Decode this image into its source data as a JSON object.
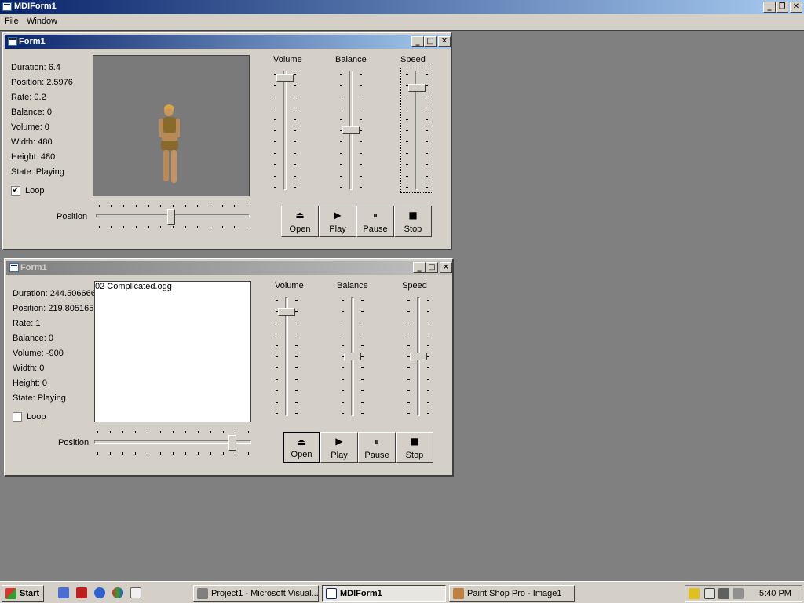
{
  "mdi": {
    "title": "MDIForm1"
  },
  "menu": {
    "items": [
      "File",
      "Window"
    ]
  },
  "form1": {
    "title": "Form1",
    "info": [
      "Duration: 6.4",
      "Position: 2.5976",
      "Rate: 0.2",
      "Balance: 0",
      "Volume: 0",
      "Width: 480",
      "Height: 480",
      "State: Playing"
    ],
    "loop_label": "Loop",
    "loop_checked": true,
    "position_label": "Position",
    "position_value": 0.49,
    "slider_labels": {
      "volume": "Volume",
      "balance": "Balance",
      "speed": "Speed"
    },
    "slider_values": {
      "volume": 0.03,
      "balance": 0.5,
      "speed": 0.12
    },
    "buttons": [
      "Open",
      "Play",
      "Pause",
      "Stop"
    ]
  },
  "form2": {
    "title": "Form1",
    "info": [
      "Duration: 244.506666",
      "Position: 219.8051656",
      "Rate: 1",
      "Balance: 0",
      "Volume: -900",
      "Width: 0",
      "Height: 0",
      "State: Playing"
    ],
    "file_name": "02 Complicated.ogg",
    "loop_label": "Loop",
    "loop_checked": false,
    "position_label": "Position",
    "position_value": 0.9,
    "slider_labels": {
      "volume": "Volume",
      "balance": "Balance",
      "speed": "Speed"
    },
    "slider_values": {
      "volume": 0.1,
      "balance": 0.5,
      "speed": 0.5
    },
    "buttons": [
      "Open",
      "Play",
      "Pause",
      "Stop"
    ]
  },
  "taskbar": {
    "start": "Start",
    "tasks": [
      "Project1 - Microsoft Visual...",
      "MDIForm1",
      "Paint Shop Pro - Image1"
    ],
    "clock": "5:40 PM"
  },
  "icons": {
    "button_icons": [
      "eject-icon",
      "play-icon",
      "pause-icon",
      "stop-icon"
    ]
  }
}
